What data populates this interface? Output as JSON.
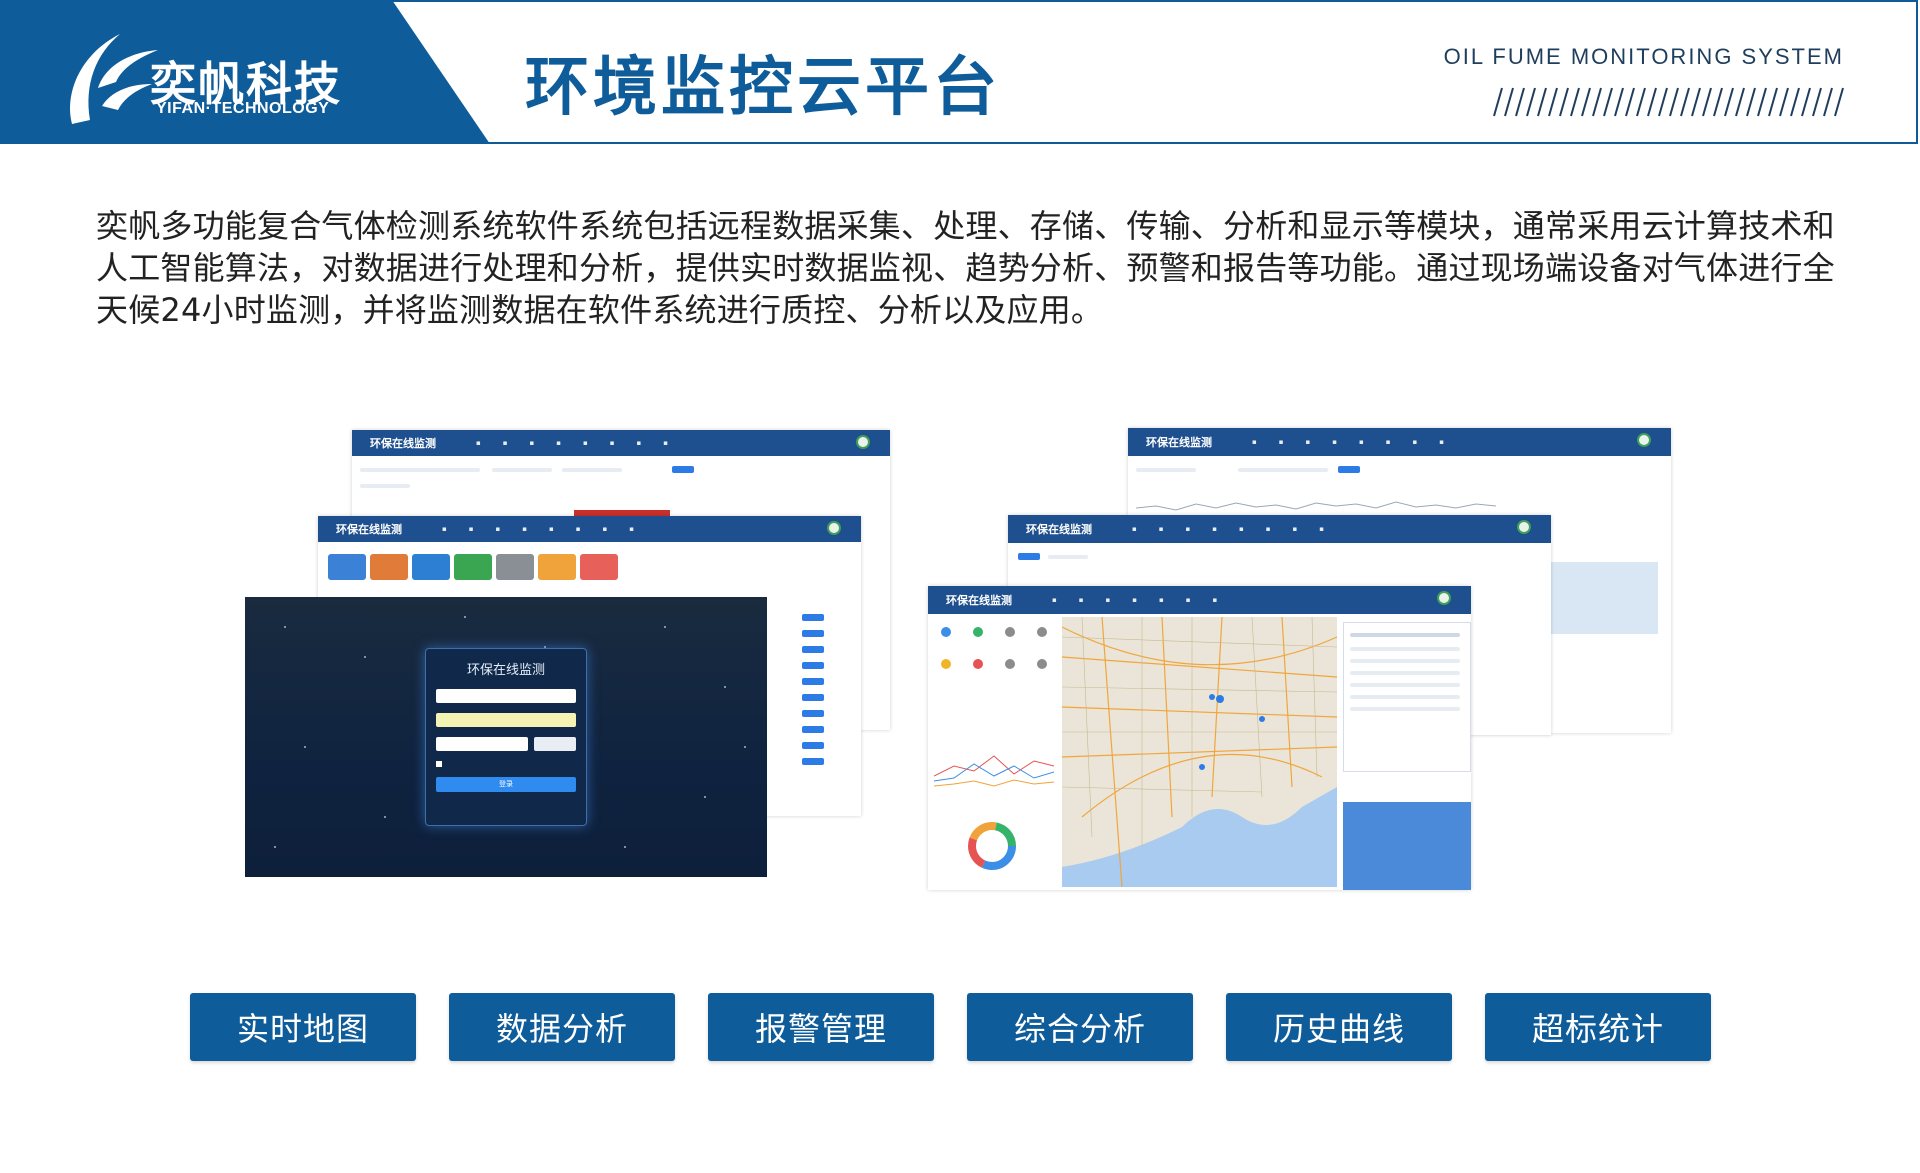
{
  "header": {
    "logo_cn": "奕帆科技",
    "logo_en": "YIFAN·TECHNOLOGY",
    "title": "环境监控云平台",
    "system_name": "OIL FUME MONITORING SYSTEM",
    "decor": "////////////////////////////////"
  },
  "intro": "奕帆多功能复合气体检测系统软件系统包括远程数据采集、处理、存储、传输、分析和显示等模块，通常采用云计算技术和人工智能算法，对数据进行处理和分析，提供实时数据监视、趋势分析、预警和报告等功能。通过现场端设备对气体进行全天候24小时监测，并将监测数据在软件系统进行质控、分析以及应用。",
  "screens": {
    "app_name": "环保在线监测",
    "login_title": "环保在线监测",
    "login_button": "登录"
  },
  "features": [
    {
      "label": "实时地图"
    },
    {
      "label": "数据分析"
    },
    {
      "label": "报警管理"
    },
    {
      "label": "综合分析"
    },
    {
      "label": "历史曲线"
    },
    {
      "label": "超标统计"
    }
  ],
  "colors": {
    "brand_blue": "#0f5c9a",
    "nav_blue": "#1e4f8f"
  }
}
